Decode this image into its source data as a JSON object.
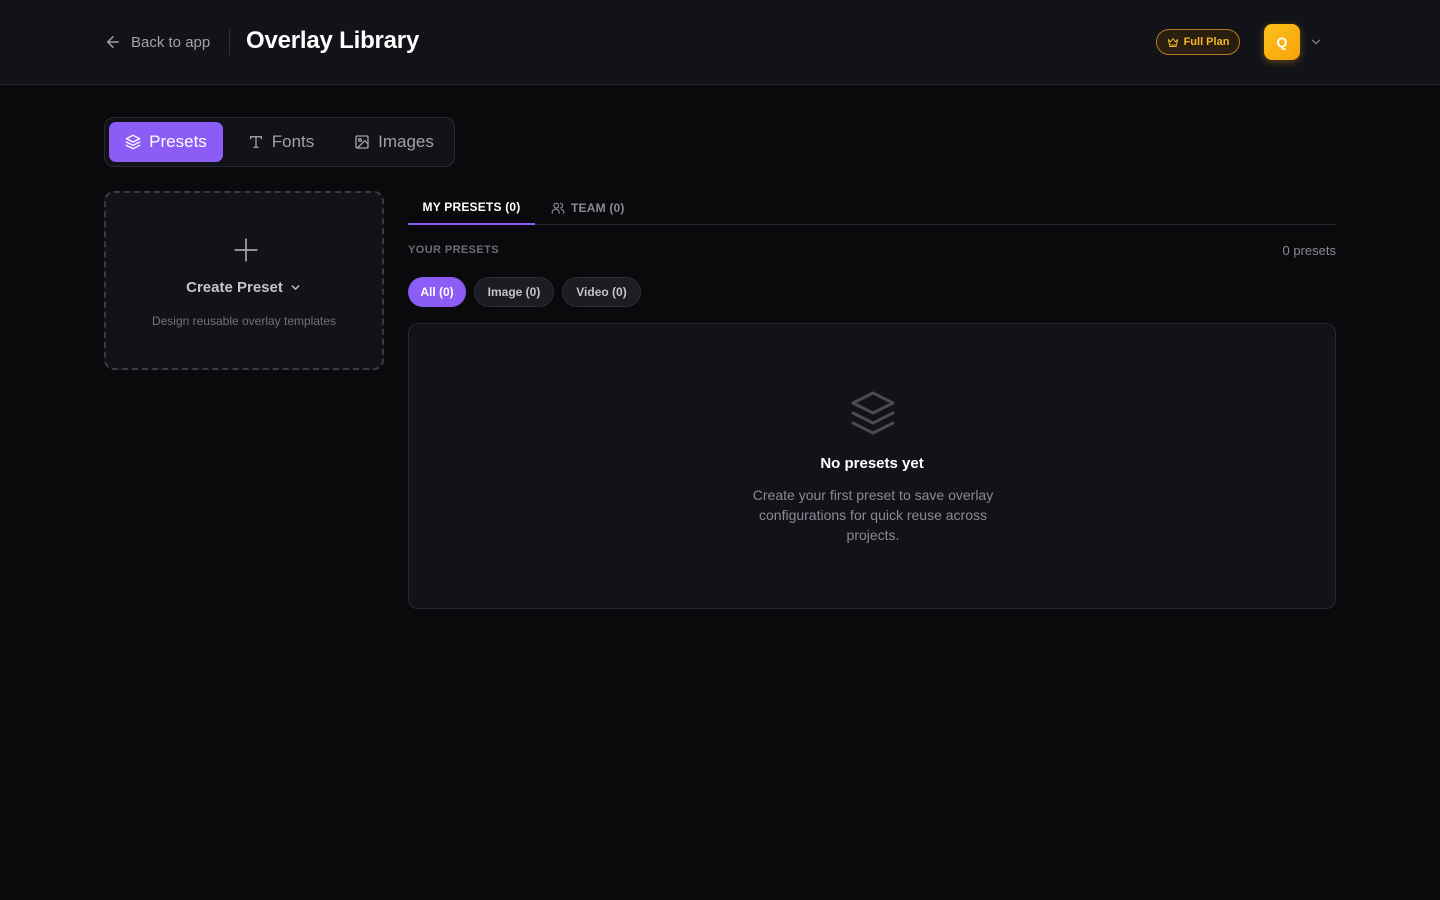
{
  "header": {
    "back_label": "Back to app",
    "title": "Overlay Library",
    "plan_badge": "Full Plan",
    "avatar_initial": "Q"
  },
  "segments": [
    {
      "label": "Presets",
      "icon": "layers-icon",
      "active": true
    },
    {
      "label": "Fonts",
      "icon": "type-icon",
      "active": false
    },
    {
      "label": "Images",
      "icon": "image-icon",
      "active": false
    }
  ],
  "create_card": {
    "label": "Create Preset",
    "hint": "Design reusable overlay templates"
  },
  "tabs": [
    {
      "label": "MY PRESETS (0)",
      "active": true
    },
    {
      "label": "TEAM (0)",
      "icon": "users-icon",
      "active": false
    }
  ],
  "list": {
    "section_label": "YOUR PRESETS",
    "count_label": "0 presets"
  },
  "filters": [
    {
      "label": "All (0)",
      "active": true
    },
    {
      "label": "Image (0)",
      "active": false
    },
    {
      "label": "Video (0)",
      "active": false
    }
  ],
  "empty_state": {
    "icon": "layers-icon",
    "title": "No presets yet",
    "description": "Create your first preset to save overlay configurations for quick reuse across projects."
  },
  "colors": {
    "background": "#0a0a0d",
    "surface": "#121219",
    "accent": "#8b5cf6",
    "plan": "#f5b62a",
    "avatar": "#ffb214"
  }
}
